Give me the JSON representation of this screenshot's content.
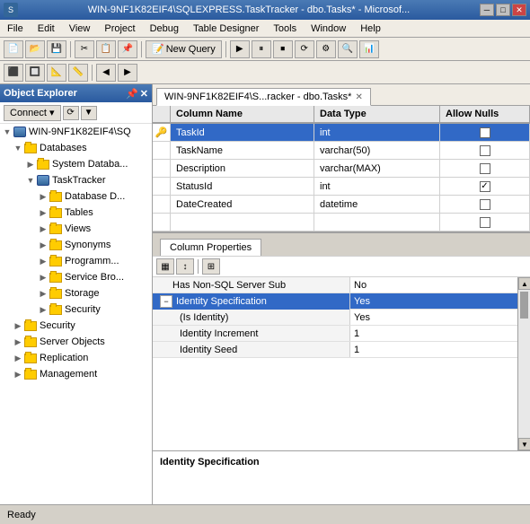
{
  "titlebar": {
    "text": "WIN-9NF1K82EIF4\\SQLEXPRESS.TaskTracker - dbo.Tasks* - Microsof...",
    "min": "─",
    "max": "□",
    "close": "✕"
  },
  "menubar": {
    "items": [
      "File",
      "Edit",
      "View",
      "Project",
      "Debug",
      "Table Designer",
      "Tools",
      "Window",
      "Help"
    ]
  },
  "toolbar": {
    "new_query": "New Query"
  },
  "object_explorer": {
    "title": "Object Explorer",
    "connect_btn": "Connect ▾",
    "tree": {
      "server": "WIN-9NF1K82EIF4\\SQ",
      "databases": "Databases",
      "system_databases": "System Databa...",
      "task_tracker": "TaskTracker",
      "database_d": "Database D...",
      "tables": "Tables",
      "views": "Views",
      "synonyms": "Synonyms",
      "programmability": "Programm...",
      "service_broker": "Service Bro...",
      "storage": "Storage",
      "security_inner": "Security",
      "security_outer": "Security",
      "server_objects": "Server Objects",
      "replication": "Replication",
      "management": "Management"
    }
  },
  "tab": {
    "label": "WIN-9NF1K82EIF4\\S...racker - dbo.Tasks*",
    "close": "✕"
  },
  "table_designer": {
    "headers": [
      "Column Name",
      "Data Type",
      "Allow Nulls"
    ],
    "rows": [
      {
        "key": true,
        "name": "TaskId",
        "type": "int",
        "nullable": false,
        "checked": false
      },
      {
        "key": false,
        "name": "TaskName",
        "type": "varchar(50)",
        "nullable": false,
        "checked": false
      },
      {
        "key": false,
        "name": "Description",
        "type": "varchar(MAX)",
        "nullable": false,
        "checked": false
      },
      {
        "key": false,
        "name": "StatusId",
        "type": "int",
        "nullable": true,
        "checked": true
      },
      {
        "key": false,
        "name": "DateCreated",
        "type": "datetime",
        "nullable": false,
        "checked": false
      },
      {
        "key": false,
        "name": "",
        "type": "",
        "nullable": false,
        "checked": false
      }
    ]
  },
  "column_properties": {
    "tab_label": "Column Properties",
    "props": [
      {
        "key": "Has Non-SQL Server Sub",
        "value": "No",
        "level": 0,
        "selected": false,
        "expandable": false
      },
      {
        "key": "Identity Specification",
        "value": "Yes",
        "level": 0,
        "selected": true,
        "expandable": true,
        "expanded": true
      },
      {
        "key": "(Is Identity)",
        "value": "Yes",
        "level": 1,
        "selected": false,
        "expandable": false
      },
      {
        "key": "Identity Increment",
        "value": "1",
        "level": 1,
        "selected": false,
        "expandable": false
      },
      {
        "key": "Identity Seed",
        "value": "1",
        "level": 1,
        "selected": false,
        "expandable": false
      }
    ],
    "description_title": "Identity Specification",
    "description_text": ""
  },
  "status_bar": {
    "text": "Ready"
  }
}
